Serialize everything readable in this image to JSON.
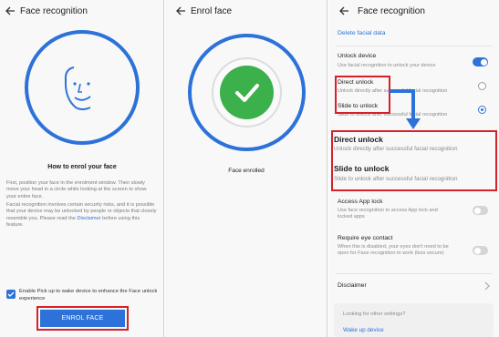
{
  "panel1": {
    "title": "Face recognition",
    "heading": "How to enrol your face",
    "description": "First, position your face in the enrolment window. Then slowly move your head in a circle while looking at the screen to show your entire face.",
    "description2_pre": "Facial recognition involves certain security risks, and it is possible that your device may be unlocked by people or objects that closely resemble you. Please read the ",
    "disclaimer_link": "Disclaimer",
    "description2_post": " before using this feature.",
    "checkbox_label": "Enable Pick up to wake device to enhance the Face unlock experience",
    "enrol_button": "ENROL FACE"
  },
  "panel2": {
    "title": "Enrol face",
    "status": "Face enrolled"
  },
  "panel3": {
    "title": "Face recognition",
    "delete_link": "Delete facial data",
    "unlock_device": {
      "title": "Unlock device",
      "subtitle": "Use facial recognition to unlock your device"
    },
    "direct_unlock": {
      "title": "Direct unlock",
      "subtitle": "Unlock directly after successful facial recognition"
    },
    "slide_to_unlock": {
      "title": "Slide to unlock",
      "subtitle": "Slide to unlock after successful facial recognition"
    },
    "zoom_direct_title": "Direct unlock",
    "zoom_direct_sub": "Unlock directly after successful facial recognition",
    "zoom_slide_title": "Slide to unlock",
    "zoom_slide_sub": "Slide to unlock after successful facial recognition",
    "app_lock": {
      "title": "Access App lock",
      "subtitle": "Use face recognition to access App lock and locked apps"
    },
    "eye_contact": {
      "title": "Require eye contact",
      "subtitle": "When this is disabled, your eyes don't need to be open for Face recognition to work (less secure)"
    },
    "disclaimer": "Disclaimer",
    "other_settings": "Looking for other settings?",
    "wake_up_link": "Wake up device"
  },
  "colors": {
    "accent": "#2d72d9",
    "success": "#3cb04a",
    "highlight": "#d3222a"
  }
}
